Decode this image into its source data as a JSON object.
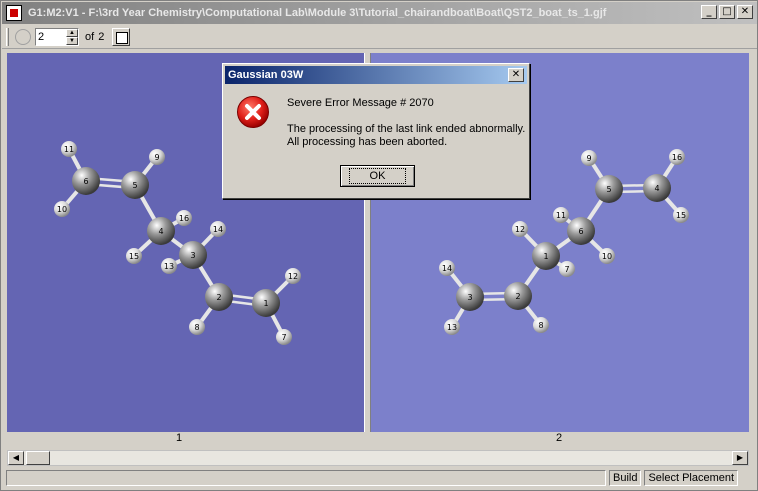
{
  "window": {
    "title": "G1:M2:V1 - F:\\3rd Year Chemistry\\Computational Lab\\Module 3\\Tutorial_chairandboat\\Boat\\QST2_boat_ts_1.gjf",
    "buttons": {
      "minimize": "_",
      "maximize": "□",
      "close": "✕"
    }
  },
  "toolbar": {
    "molecule_index": "2",
    "of_label": "of",
    "molecule_total": "2"
  },
  "panes": [
    {
      "label": "1"
    },
    {
      "label": "2"
    }
  ],
  "statusbar": {
    "mode": "Build",
    "action": "Select Placement"
  },
  "dialog": {
    "title": "Gaussian 03W",
    "close": "✕",
    "message_header": "Severe Error Message # 2070",
    "message_line1": "The processing of the last link ended abnormally.",
    "message_line2": "All processing has been aborted.",
    "ok_label": "OK",
    "icon": "error-icon"
  },
  "molecules": [
    {
      "atoms": [
        {
          "id": "1",
          "el": "C"
        },
        {
          "id": "2",
          "el": "C"
        },
        {
          "id": "3",
          "el": "C"
        },
        {
          "id": "4",
          "el": "C"
        },
        {
          "id": "5",
          "el": "C"
        },
        {
          "id": "6",
          "el": "C"
        },
        {
          "id": "7",
          "el": "H"
        },
        {
          "id": "8",
          "el": "H"
        },
        {
          "id": "9",
          "el": "H"
        },
        {
          "id": "10",
          "el": "H"
        },
        {
          "id": "11",
          "el": "H"
        },
        {
          "id": "12",
          "el": "H"
        },
        {
          "id": "13",
          "el": "H"
        },
        {
          "id": "14",
          "el": "H"
        },
        {
          "id": "15",
          "el": "H"
        },
        {
          "id": "16",
          "el": "H"
        }
      ]
    },
    {
      "atoms": [
        {
          "id": "1",
          "el": "C"
        },
        {
          "id": "2",
          "el": "C"
        },
        {
          "id": "3",
          "el": "C"
        },
        {
          "id": "4",
          "el": "C"
        },
        {
          "id": "5",
          "el": "C"
        },
        {
          "id": "6",
          "el": "C"
        },
        {
          "id": "7",
          "el": "H"
        },
        {
          "id": "8",
          "el": "H"
        },
        {
          "id": "9",
          "el": "H"
        },
        {
          "id": "10",
          "el": "H"
        },
        {
          "id": "11",
          "el": "H"
        },
        {
          "id": "12",
          "el": "H"
        },
        {
          "id": "13",
          "el": "H"
        },
        {
          "id": "14",
          "el": "H"
        },
        {
          "id": "15",
          "el": "H"
        },
        {
          "id": "16",
          "el": "H"
        }
      ]
    }
  ]
}
